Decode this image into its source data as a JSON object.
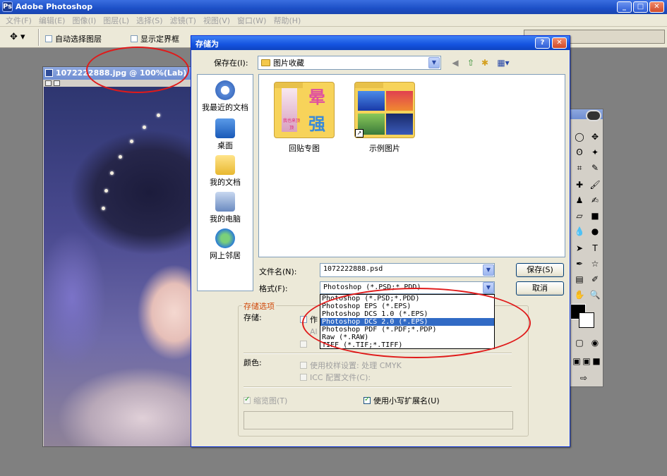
{
  "app": {
    "title": "Adobe Photoshop",
    "logo": "Ps"
  },
  "menu": [
    "文件(F)",
    "编辑(E)",
    "图像(I)",
    "图层(L)",
    "选择(S)",
    "滤镜(T)",
    "视图(V)",
    "窗口(W)",
    "帮助(H)"
  ],
  "options_bar": {
    "auto_select": "自动选择图层",
    "show_bounds": "显示定界框"
  },
  "document": {
    "title": "1072222888.jpg @ 100%(Lab)"
  },
  "dialog": {
    "title": "存储为",
    "save_in_label": "保存在(I):",
    "save_in_value": "图片收藏",
    "places": [
      "我最近的文档",
      "桌面",
      "我的文档",
      "我的电脑",
      "网上邻居"
    ],
    "folders": [
      "回贴专图",
      "示例图片"
    ],
    "folder_thumb_text": {
      "line1": "晕",
      "line2": "强",
      "caption": "我也来顶顶"
    },
    "filename_label": "文件名(N):",
    "filename_value": "1072222888.psd",
    "format_label": "格式(F):",
    "format_value": "Photoshop (*.PSD;*.PDD)",
    "format_options": [
      "Photoshop (*.PSD;*.PDD)",
      "Photoshop EPS (*.EPS)",
      "Photoshop DCS 1.0 (*.EPS)",
      "Photoshop DCS 2.0 (*.EPS)",
      "Photoshop PDF (*.PDF;*.PDP)",
      "Raw (*.RAW)",
      "TIFF (*.TIF;*.TIFF)"
    ],
    "format_selected_index": 3,
    "save_button": "保存(S)",
    "cancel_button": "取消",
    "options_group": "存储选项",
    "save_label": "存储:",
    "save_partial_1": "作",
    "save_partial_2": "Al",
    "color_label": "颜色:",
    "proof_setup": "使用校样设置: 处理 CMYK",
    "icc_profile": "ICC 配置文件(C):",
    "thumbnail": "缩览图(T)",
    "lowercase_ext": "使用小写扩展名(U)"
  },
  "colors": {
    "annotation": "#e01a1a",
    "title_bar": "#1453e0",
    "selection": "#316ac5"
  }
}
